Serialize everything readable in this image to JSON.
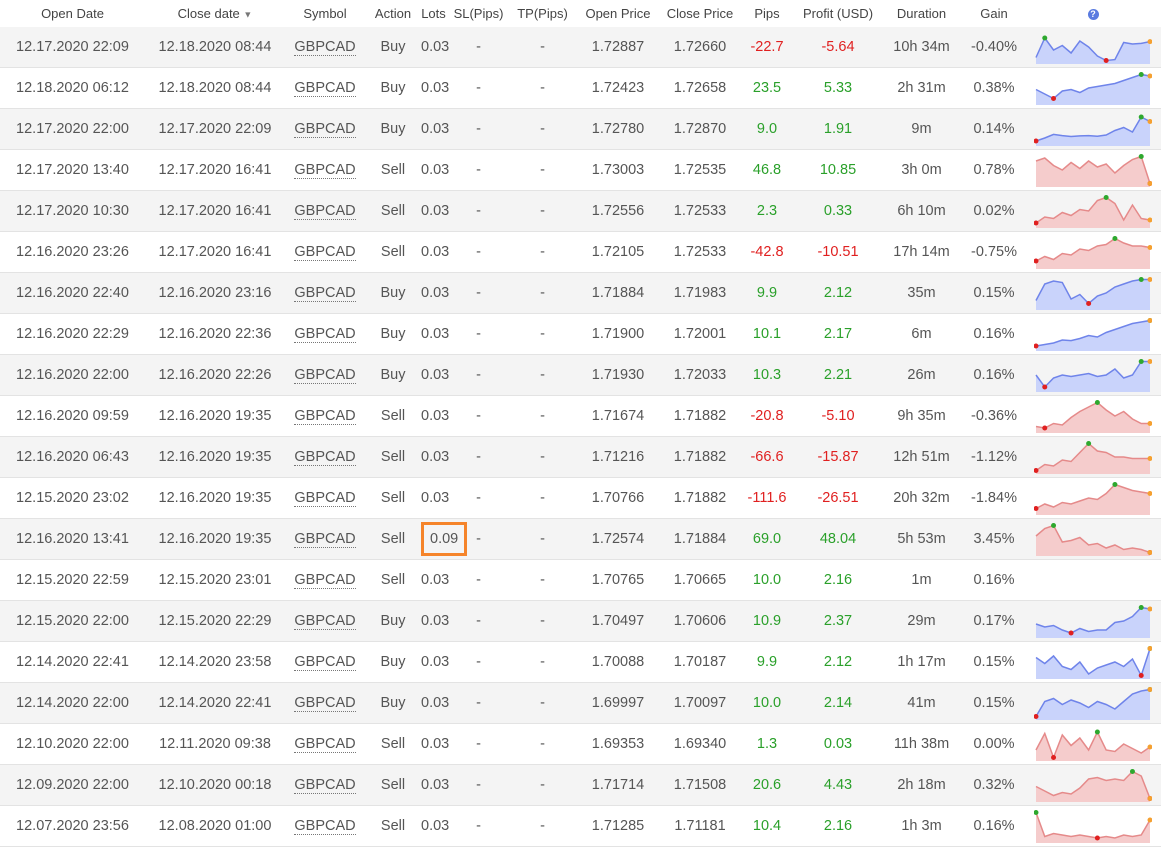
{
  "headers": {
    "open_date": "Open Date",
    "close_date": "Close date",
    "symbol": "Symbol",
    "action": "Action",
    "lots": "Lots",
    "sl": "SL(Pips)",
    "tp": "TP(Pips)",
    "open_price": "Open Price",
    "close_price": "Close Price",
    "pips": "Pips",
    "profit": "Profit (USD)",
    "duration": "Duration",
    "gain": "Gain",
    "help_icon": "question-circle-icon"
  },
  "colors": {
    "negative": "#e02020",
    "positive": "#2aa02a",
    "buy_fill": "#c9d3fb",
    "buy_line": "#6f84ea",
    "sell_fill": "#f5cccc",
    "sell_line": "#e58a8a",
    "highlight": "#f5842a"
  },
  "highlighted_row": 12,
  "rows": [
    {
      "open": "12.17.2020 22:09",
      "close": "12.18.2020 08:44",
      "symbol": "GBPCAD",
      "action": "Buy",
      "lots": "0.03",
      "sl": "-",
      "tp": "-",
      "open_price": "1.72887",
      "close_price": "1.72660",
      "pips": "-22.7",
      "profit": "-5.64",
      "duration": "10h 34m",
      "gain": "-0.40%",
      "spark": [
        0.85,
        0.2,
        0.6,
        0.45,
        0.7,
        0.3,
        0.5,
        0.8,
        0.95,
        0.92,
        0.35,
        0.4,
        0.38,
        0.32
      ]
    },
    {
      "open": "12.18.2020 06:12",
      "close": "12.18.2020 08:44",
      "symbol": "GBPCAD",
      "action": "Buy",
      "lots": "0.03",
      "sl": "-",
      "tp": "-",
      "open_price": "1.72423",
      "close_price": "1.72658",
      "pips": "23.5",
      "profit": "5.33",
      "duration": "2h 31m",
      "gain": "0.38%",
      "spark": [
        0.55,
        0.7,
        0.85,
        0.6,
        0.55,
        0.65,
        0.5,
        0.45,
        0.4,
        0.35,
        0.25,
        0.15,
        0.05,
        0.1
      ]
    },
    {
      "open": "12.17.2020 22:00",
      "close": "12.17.2020 22:09",
      "symbol": "GBPCAD",
      "action": "Buy",
      "lots": "0.03",
      "sl": "-",
      "tp": "-",
      "open_price": "1.72780",
      "close_price": "1.72870",
      "pips": "9.0",
      "profit": "1.91",
      "duration": "9m",
      "gain": "0.14%",
      "spark": [
        0.9,
        0.8,
        0.68,
        0.72,
        0.75,
        0.73,
        0.72,
        0.74,
        0.7,
        0.55,
        0.45,
        0.6,
        0.1,
        0.25
      ]
    },
    {
      "open": "12.17.2020 13:40",
      "close": "12.17.2020 16:41",
      "symbol": "GBPCAD",
      "action": "Sell",
      "lots": "0.03",
      "sl": "-",
      "tp": "-",
      "open_price": "1.73003",
      "close_price": "1.72535",
      "pips": "46.8",
      "profit": "10.85",
      "duration": "3h 0m",
      "gain": "0.78%",
      "spark": [
        0.2,
        0.1,
        0.35,
        0.5,
        0.25,
        0.45,
        0.2,
        0.4,
        0.3,
        0.6,
        0.35,
        0.15,
        0.05,
        0.95
      ]
    },
    {
      "open": "12.17.2020 10:30",
      "close": "12.17.2020 16:41",
      "symbol": "GBPCAD",
      "action": "Sell",
      "lots": "0.03",
      "sl": "-",
      "tp": "-",
      "open_price": "1.72556",
      "close_price": "1.72533",
      "pips": "2.3",
      "profit": "0.33",
      "duration": "6h 10m",
      "gain": "0.02%",
      "spark": [
        0.9,
        0.7,
        0.75,
        0.55,
        0.65,
        0.45,
        0.5,
        0.15,
        0.05,
        0.25,
        0.8,
        0.3,
        0.75,
        0.8
      ]
    },
    {
      "open": "12.16.2020 23:26",
      "close": "12.17.2020 16:41",
      "symbol": "GBPCAD",
      "action": "Sell",
      "lots": "0.03",
      "sl": "-",
      "tp": "-",
      "open_price": "1.72105",
      "close_price": "1.72533",
      "pips": "-42.8",
      "profit": "-10.51",
      "duration": "17h 14m",
      "gain": "-0.75%",
      "spark": [
        0.8,
        0.65,
        0.75,
        0.55,
        0.6,
        0.4,
        0.45,
        0.3,
        0.25,
        0.05,
        0.2,
        0.3,
        0.3,
        0.35
      ]
    },
    {
      "open": "12.16.2020 22:40",
      "close": "12.16.2020 23:16",
      "symbol": "GBPCAD",
      "action": "Buy",
      "lots": "0.03",
      "sl": "-",
      "tp": "-",
      "open_price": "1.71884",
      "close_price": "1.71983",
      "pips": "9.9",
      "profit": "2.12",
      "duration": "35m",
      "gain": "0.15%",
      "spark": [
        0.75,
        0.2,
        0.1,
        0.15,
        0.7,
        0.55,
        0.85,
        0.6,
        0.5,
        0.3,
        0.2,
        0.1,
        0.05,
        0.05
      ]
    },
    {
      "open": "12.16.2020 22:29",
      "close": "12.16.2020 22:36",
      "symbol": "GBPCAD",
      "action": "Buy",
      "lots": "0.03",
      "sl": "-",
      "tp": "-",
      "open_price": "1.71900",
      "close_price": "1.72001",
      "pips": "10.1",
      "profit": "2.17",
      "duration": "6m",
      "gain": "0.16%",
      "spark": [
        0.9,
        0.85,
        0.8,
        0.7,
        0.72,
        0.65,
        0.55,
        0.6,
        0.45,
        0.35,
        0.25,
        0.15,
        0.1,
        0.05
      ]
    },
    {
      "open": "12.16.2020 22:00",
      "close": "12.16.2020 22:26",
      "symbol": "GBPCAD",
      "action": "Buy",
      "lots": "0.03",
      "sl": "-",
      "tp": "-",
      "open_price": "1.71930",
      "close_price": "1.72033",
      "pips": "10.3",
      "profit": "2.21",
      "duration": "26m",
      "gain": "0.16%",
      "spark": [
        0.5,
        0.9,
        0.6,
        0.5,
        0.55,
        0.5,
        0.45,
        0.55,
        0.5,
        0.3,
        0.6,
        0.5,
        0.05,
        0.05
      ]
    },
    {
      "open": "12.16.2020 09:59",
      "close": "12.16.2020 19:35",
      "symbol": "GBPCAD",
      "action": "Sell",
      "lots": "0.03",
      "sl": "-",
      "tp": "-",
      "open_price": "1.71674",
      "close_price": "1.71882",
      "pips": "-20.8",
      "profit": "-5.10",
      "duration": "9h 35m",
      "gain": "-0.36%",
      "spark": [
        0.85,
        0.9,
        0.75,
        0.8,
        0.55,
        0.35,
        0.2,
        0.05,
        0.3,
        0.5,
        0.35,
        0.6,
        0.75,
        0.75
      ]
    },
    {
      "open": "12.16.2020 06:43",
      "close": "12.16.2020 19:35",
      "symbol": "GBPCAD",
      "action": "Sell",
      "lots": "0.03",
      "sl": "-",
      "tp": "-",
      "open_price": "1.71216",
      "close_price": "1.71882",
      "pips": "-66.6",
      "profit": "-15.87",
      "duration": "12h 51m",
      "gain": "-1.12%",
      "spark": [
        0.95,
        0.75,
        0.8,
        0.6,
        0.65,
        0.35,
        0.05,
        0.3,
        0.35,
        0.5,
        0.5,
        0.55,
        0.55,
        0.55
      ]
    },
    {
      "open": "12.15.2020 23:02",
      "close": "12.16.2020 19:35",
      "symbol": "GBPCAD",
      "action": "Sell",
      "lots": "0.03",
      "sl": "-",
      "tp": "-",
      "open_price": "1.70766",
      "close_price": "1.71882",
      "pips": "-111.6",
      "profit": "-26.51",
      "duration": "20h 32m",
      "gain": "-1.84%",
      "spark": [
        0.85,
        0.7,
        0.8,
        0.65,
        0.7,
        0.6,
        0.5,
        0.55,
        0.35,
        0.05,
        0.15,
        0.25,
        0.3,
        0.35
      ]
    },
    {
      "open": "12.16.2020 13:41",
      "close": "12.16.2020 19:35",
      "symbol": "GBPCAD",
      "action": "Sell",
      "lots": "0.09",
      "sl": "-",
      "tp": "-",
      "open_price": "1.72574",
      "close_price": "1.71884",
      "pips": "69.0",
      "profit": "48.04",
      "duration": "5h 53m",
      "gain": "3.45%",
      "spark": [
        0.4,
        0.15,
        0.05,
        0.6,
        0.55,
        0.45,
        0.7,
        0.65,
        0.8,
        0.7,
        0.85,
        0.8,
        0.85,
        0.95
      ]
    },
    {
      "open": "12.15.2020 22:59",
      "close": "12.15.2020 23:01",
      "symbol": "GBPCAD",
      "action": "Sell",
      "lots": "0.03",
      "sl": "-",
      "tp": "-",
      "open_price": "1.70765",
      "close_price": "1.70665",
      "pips": "10.0",
      "profit": "2.16",
      "duration": "1m",
      "gain": "0.16%",
      "spark": null
    },
    {
      "open": "12.15.2020 22:00",
      "close": "12.15.2020 22:29",
      "symbol": "GBPCAD",
      "action": "Buy",
      "lots": "0.03",
      "sl": "-",
      "tp": "-",
      "open_price": "1.70497",
      "close_price": "1.70606",
      "pips": "10.9",
      "profit": "2.37",
      "duration": "29m",
      "gain": "0.17%",
      "spark": [
        0.6,
        0.7,
        0.65,
        0.8,
        0.9,
        0.75,
        0.85,
        0.8,
        0.8,
        0.55,
        0.5,
        0.35,
        0.05,
        0.1
      ]
    },
    {
      "open": "12.14.2020 22:41",
      "close": "12.14.2020 23:58",
      "symbol": "GBPCAD",
      "action": "Buy",
      "lots": "0.03",
      "sl": "-",
      "tp": "-",
      "open_price": "1.70088",
      "close_price": "1.70187",
      "pips": "9.9",
      "profit": "2.12",
      "duration": "1h 17m",
      "gain": "0.15%",
      "spark": [
        0.35,
        0.55,
        0.3,
        0.65,
        0.75,
        0.5,
        0.9,
        0.7,
        0.6,
        0.5,
        0.65,
        0.4,
        0.95,
        0.05
      ]
    },
    {
      "open": "12.14.2020 22:00",
      "close": "12.14.2020 22:41",
      "symbol": "GBPCAD",
      "action": "Buy",
      "lots": "0.03",
      "sl": "-",
      "tp": "-",
      "open_price": "1.69997",
      "close_price": "1.70097",
      "pips": "10.0",
      "profit": "2.14",
      "duration": "41m",
      "gain": "0.15%",
      "spark": [
        0.95,
        0.45,
        0.35,
        0.55,
        0.4,
        0.5,
        0.65,
        0.45,
        0.55,
        0.7,
        0.45,
        0.2,
        0.1,
        0.05
      ]
    },
    {
      "open": "12.10.2020 22:00",
      "close": "12.11.2020 09:38",
      "symbol": "GBPCAD",
      "action": "Sell",
      "lots": "0.03",
      "sl": "-",
      "tp": "-",
      "open_price": "1.69353",
      "close_price": "1.69340",
      "pips": "1.3",
      "profit": "0.03",
      "duration": "11h 38m",
      "gain": "0.00%",
      "spark": [
        0.7,
        0.15,
        0.95,
        0.2,
        0.55,
        0.3,
        0.7,
        0.1,
        0.7,
        0.75,
        0.5,
        0.65,
        0.8,
        0.6
      ]
    },
    {
      "open": "12.09.2020 22:00",
      "close": "12.10.2020 00:18",
      "symbol": "GBPCAD",
      "action": "Sell",
      "lots": "0.03",
      "sl": "-",
      "tp": "-",
      "open_price": "1.71714",
      "close_price": "1.71508",
      "pips": "20.6",
      "profit": "4.43",
      "duration": "2h 18m",
      "gain": "0.32%",
      "spark": [
        0.55,
        0.7,
        0.85,
        0.75,
        0.8,
        0.6,
        0.3,
        0.25,
        0.35,
        0.3,
        0.35,
        0.05,
        0.2,
        0.95
      ]
    },
    {
      "open": "12.07.2020 23:56",
      "close": "12.08.2020 01:00",
      "symbol": "GBPCAD",
      "action": "Sell",
      "lots": "0.03",
      "sl": "-",
      "tp": "-",
      "open_price": "1.71285",
      "close_price": "1.71181",
      "pips": "10.4",
      "profit": "2.16",
      "duration": "1h 3m",
      "gain": "0.16%",
      "spark": [
        0.05,
        0.85,
        0.75,
        0.8,
        0.85,
        0.8,
        0.85,
        0.9,
        0.85,
        0.9,
        0.8,
        0.85,
        0.8,
        0.3
      ]
    }
  ]
}
